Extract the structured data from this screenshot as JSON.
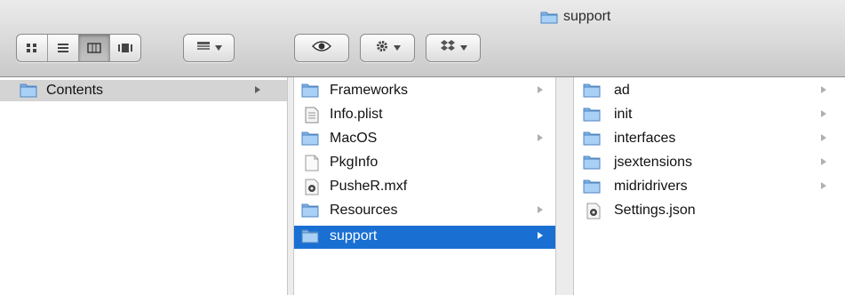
{
  "window": {
    "title": "support"
  },
  "toolbar": {
    "view_modes": [
      {
        "icon": "icon-view-icon",
        "active": false
      },
      {
        "icon": "list-view-icon",
        "active": false
      },
      {
        "icon": "column-view-icon",
        "active": true
      },
      {
        "icon": "cover-flow-icon",
        "active": false
      }
    ],
    "arrange_icon": "arrange-icon",
    "quicklook_icon": "eye-icon",
    "action_icon": "gear-icon",
    "dropbox_icon": "dropbox-icon"
  },
  "columns": [
    {
      "items": [
        {
          "name": "Contents",
          "type": "folder",
          "has_children": true,
          "state": "parent-selected"
        }
      ]
    },
    {
      "items": [
        {
          "name": "Frameworks",
          "type": "folder",
          "has_children": true
        },
        {
          "name": "Info.plist",
          "type": "plist",
          "has_children": false
        },
        {
          "name": "MacOS",
          "type": "folder",
          "has_children": true
        },
        {
          "name": "PkgInfo",
          "type": "file",
          "has_children": false
        },
        {
          "name": "PusheR.mxf",
          "type": "app-file",
          "has_children": false
        },
        {
          "name": "Resources",
          "type": "folder",
          "has_children": true
        },
        {
          "name": "support",
          "type": "folder",
          "has_children": true,
          "state": "selected"
        }
      ]
    },
    {
      "items": [
        {
          "name": "ad",
          "type": "folder",
          "has_children": true
        },
        {
          "name": "init",
          "type": "folder",
          "has_children": true
        },
        {
          "name": "interfaces",
          "type": "folder",
          "has_children": true
        },
        {
          "name": "jsextensions",
          "type": "folder",
          "has_children": true
        },
        {
          "name": "midridrivers",
          "type": "folder",
          "has_children": true
        },
        {
          "name": "Settings.json",
          "type": "app-file",
          "has_children": false
        }
      ]
    }
  ],
  "colors": {
    "selection": "#1a6fd3",
    "folder": "#7fb3e6"
  }
}
